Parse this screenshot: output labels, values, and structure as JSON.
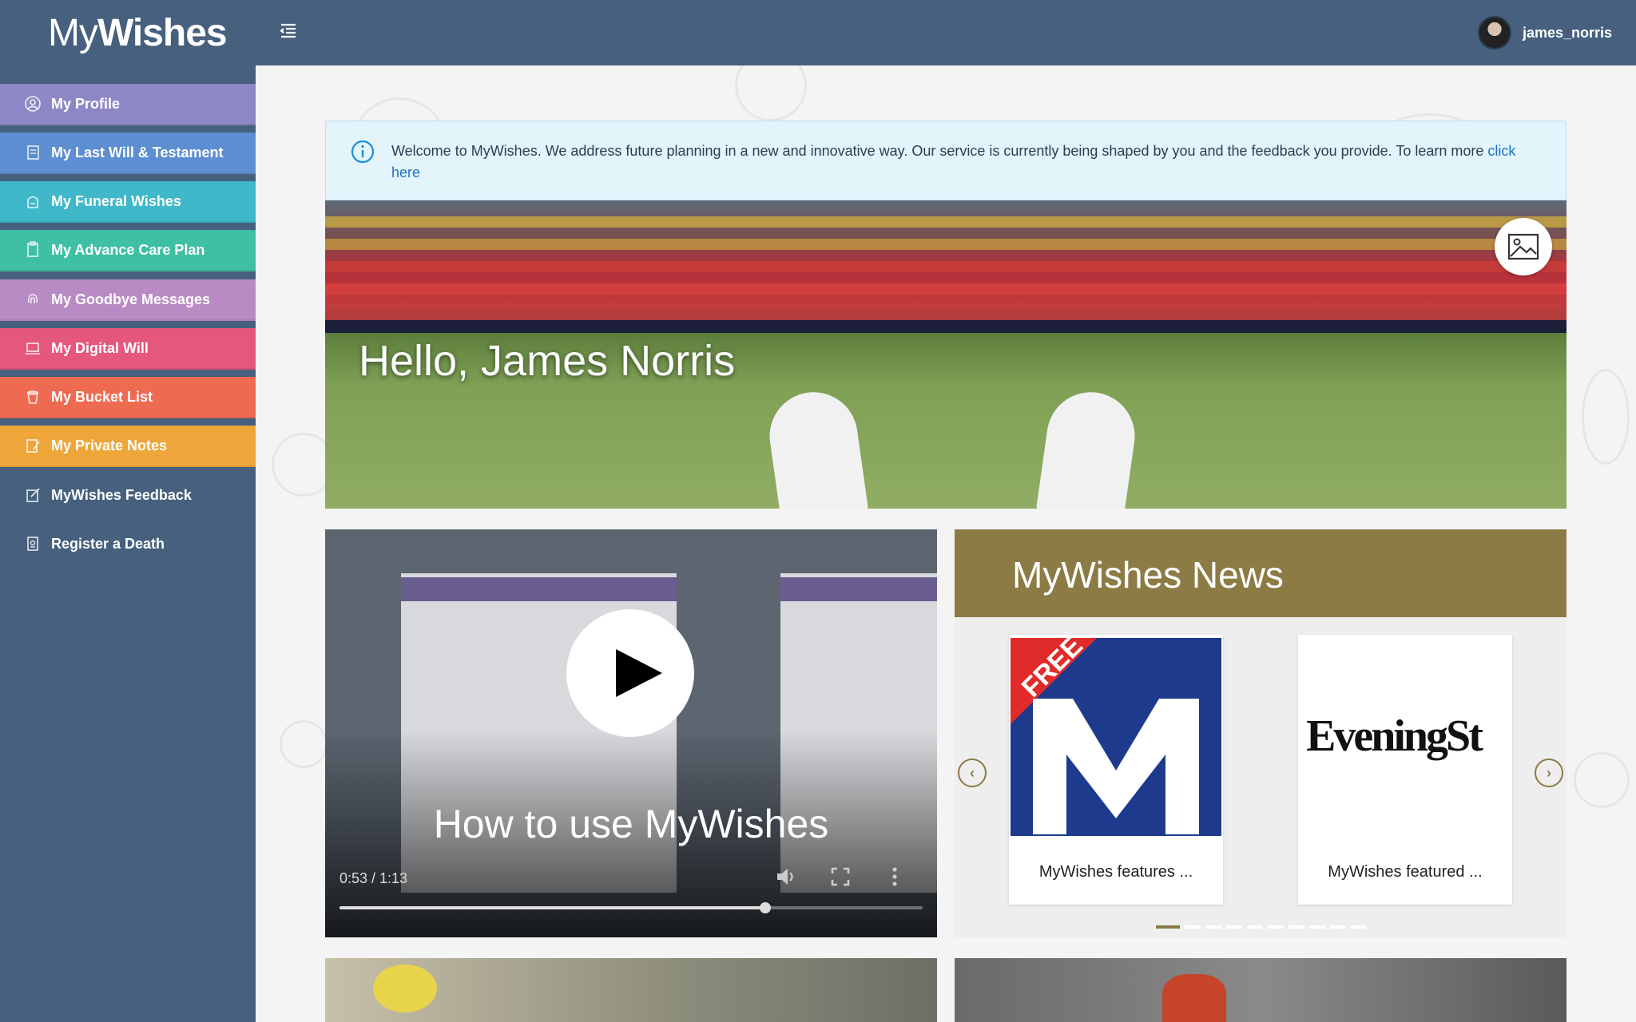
{
  "app": {
    "logo_light": "My",
    "logo_bold": "Wishes"
  },
  "user": {
    "name": "james_norris"
  },
  "sidebar": {
    "items": [
      {
        "label": "My Profile",
        "color": "#8e87c5",
        "icon": "user-circle-icon"
      },
      {
        "label": "My Last Will & Testament",
        "color": "#5d8ed1",
        "icon": "document-icon"
      },
      {
        "label": "My Funeral Wishes",
        "color": "#3fb8c9",
        "icon": "funeral-icon"
      },
      {
        "label": "My Advance Care Plan",
        "color": "#3fbfa3",
        "icon": "care-plan-icon"
      },
      {
        "label": "My Goodbye Messages",
        "color": "#b98bc5",
        "icon": "fingerprint-icon"
      },
      {
        "label": "My Digital Will",
        "color": "#e5577c",
        "icon": "laptop-icon"
      },
      {
        "label": "My Bucket List",
        "color": "#ee6a51",
        "icon": "bucket-icon"
      },
      {
        "label": "My Private Notes",
        "color": "#eea63b",
        "icon": "notes-icon"
      },
      {
        "label": "MyWishes Feedback",
        "color": "#46607e",
        "icon": "edit-icon"
      },
      {
        "label": "Register a Death",
        "color": "#46607e",
        "icon": "register-icon"
      }
    ]
  },
  "alert": {
    "text": "Welcome to MyWishes. We address future planning in a new and innovative way. Our service is currently being shaped by you and the feedback you provide. To learn more ",
    "link": "click here"
  },
  "hero": {
    "greeting": "Hello, James Norris"
  },
  "video": {
    "title": "How to use MyWishes",
    "time": "0:53 / 1:13",
    "progress": 0.73
  },
  "news": {
    "title": "MyWishes News",
    "cards": [
      {
        "caption": "MyWishes features ...",
        "logo": "FREE M"
      },
      {
        "caption": "MyWishes featured ...",
        "logo": "EveningSt"
      }
    ],
    "dot_count": 10,
    "active_dot": 0
  }
}
